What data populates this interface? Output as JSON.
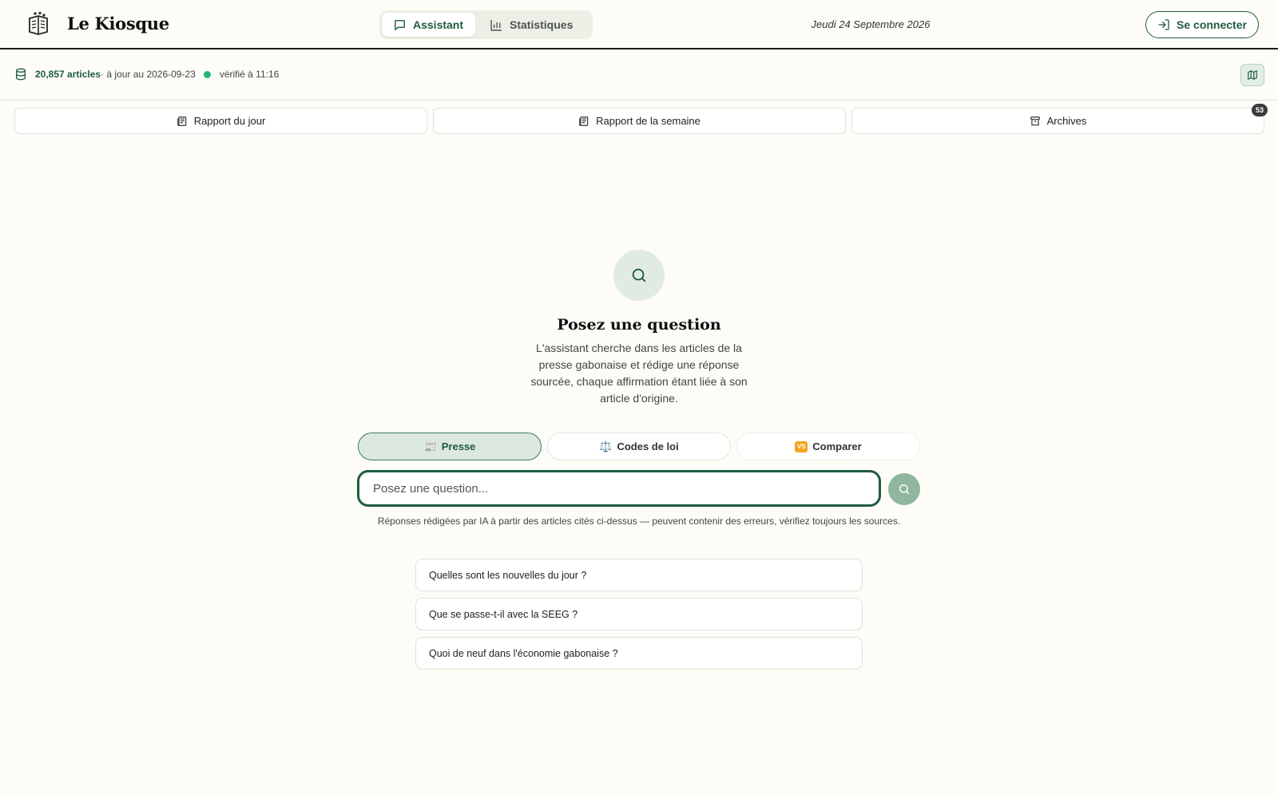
{
  "header": {
    "brand": "Le Kiosque",
    "tabs": [
      {
        "label": "Assistant",
        "icon": "chat-icon",
        "active": true
      },
      {
        "label": "Statistiques",
        "icon": "bar-chart-icon",
        "active": false
      }
    ],
    "date": "Jeudi 24 Septembre 2026",
    "login_label": "Se connecter"
  },
  "status": {
    "count": "20,857 articles",
    "updated": " · à jour au 2026-09-23",
    "verified": "vérifié à 11:16",
    "dot_color": "#22b573"
  },
  "reports": [
    {
      "label": "Rapport du jour",
      "icon": "newspaper-icon"
    },
    {
      "label": "Rapport de la semaine",
      "icon": "newspaper-icon"
    },
    {
      "label": "Archives",
      "icon": "archive-icon",
      "badge": "53"
    }
  ],
  "hero": {
    "title": "Posez une question",
    "description": "L'assistant cherche dans les articles de la presse gabonaise et rédige une réponse sourcée, chaque affirmation étant liée à son article d'origine."
  },
  "modes": [
    {
      "icon": "📰",
      "label": "Presse",
      "active": true
    },
    {
      "icon": "⚖️",
      "label": "Codes de loi",
      "active": false
    },
    {
      "icon": "VS",
      "label": "Comparer",
      "active": false
    }
  ],
  "search": {
    "placeholder": "Posez une question...",
    "disclaimer": "Réponses rédigées par IA à partir des articles cités ci-dessus — peuvent contenir des erreurs, vérifiez toujours les sources."
  },
  "suggestions": [
    "Quelles sont les nouvelles du jour ?",
    "Que se passe-t-il avec la SEEG ?",
    "Quoi de neuf dans l'économie gabonaise ?"
  ],
  "colors": {
    "accent": "#1f5c3e",
    "background": "#fdfcf7"
  }
}
